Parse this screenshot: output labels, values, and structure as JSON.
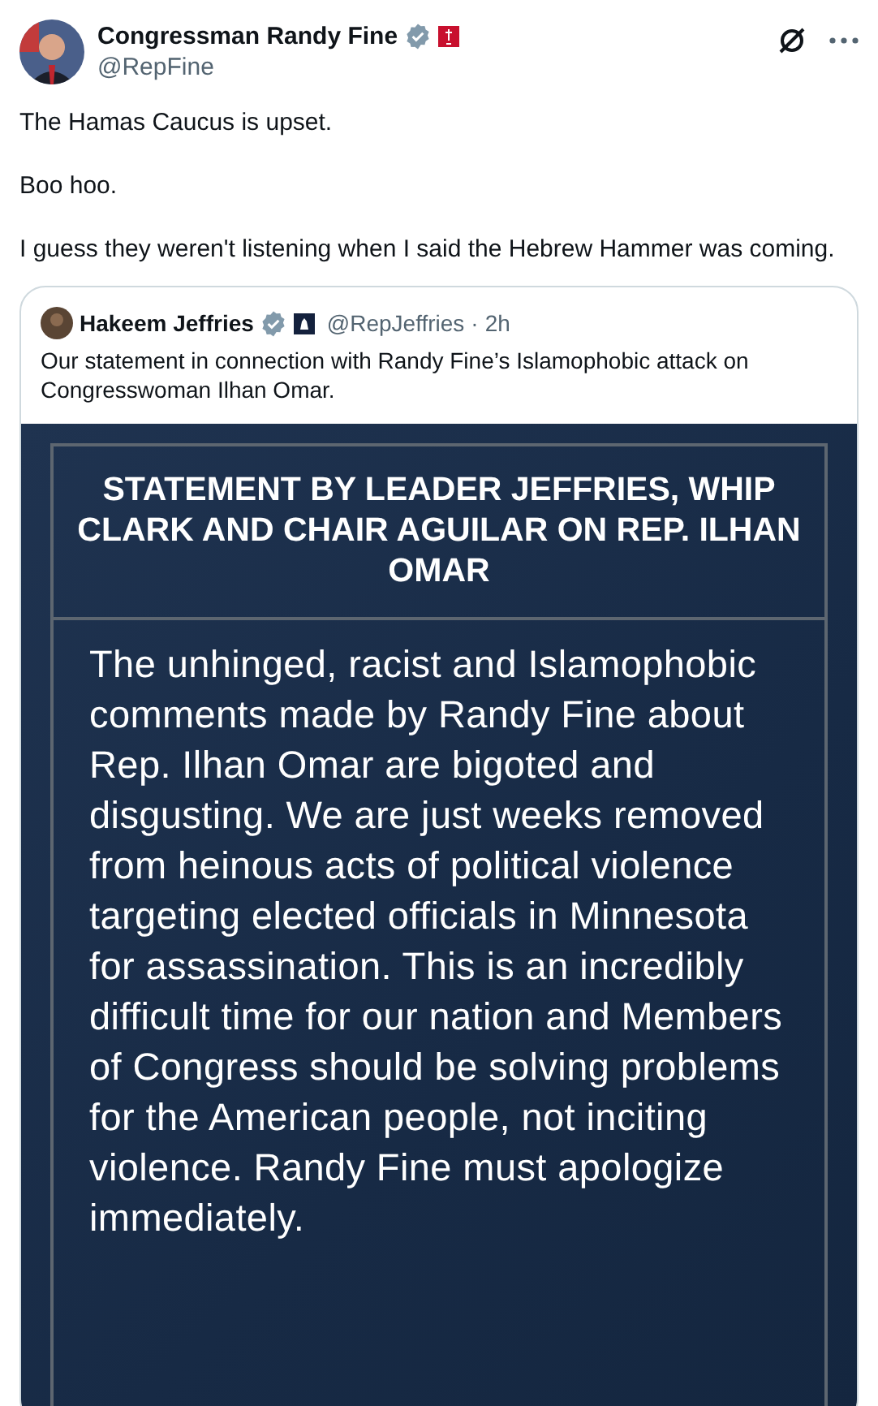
{
  "author": {
    "name": "Congressman Randy Fine",
    "handle": "@RepFine",
    "verified": true
  },
  "text": [
    "The Hamas Caucus is upset.",
    "Boo hoo.",
    "I guess they weren't listening when I said the Hebrew Hammer was coming."
  ],
  "quote": {
    "name": "Hakeem Jeffries",
    "verified": true,
    "handle": "@RepJeffries",
    "separator": "·",
    "time": "2h",
    "text": "Our statement in connection with Randy Fine’s Islamophobic attack on Congresswoman Ilhan Omar.",
    "image": {
      "title": "STATEMENT BY LEADER JEFFRIES, WHIP CLARK AND CHAIR AGUILAR ON REP. ILHAN OMAR",
      "body": "The unhinged, racist and Islamophobic comments made by Randy Fine about Rep. Ilhan Omar are bigoted and disgusting. We are just weeks removed from heinous acts of political violence targeting elected officials in Minnesota for assassination. This is an incredibly difficult time for our nation and Members of Congress should be solving problems for the American people, not inciting violence. Randy Fine must apologize immediately."
    }
  }
}
